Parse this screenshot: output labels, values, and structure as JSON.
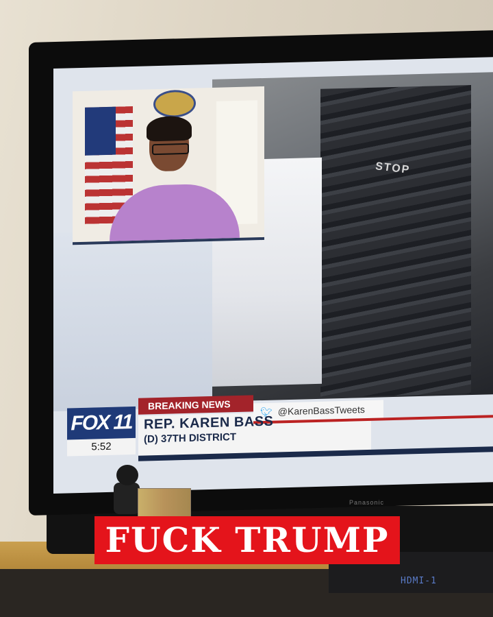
{
  "broadcast": {
    "channel_logo": "FOX 11",
    "time": "5:52",
    "banner": "BREAKING NEWS",
    "twitter_handle": "@KarenBassTweets",
    "name": "REP. KAREN BASS",
    "district": "(D) 37TH DISTRICT",
    "street_marking": "STOP",
    "colors": {
      "banner_red": "#a3232a",
      "navy": "#1b2a4a",
      "twitter_blue": "#1da1f2"
    }
  },
  "tv_brand": "Panasonic",
  "receiver_display": "HDMI-1",
  "caption": {
    "text": "FUCK TRUMP",
    "background": "#e4141b"
  },
  "icons": {
    "twitter": "twitter-icon"
  }
}
